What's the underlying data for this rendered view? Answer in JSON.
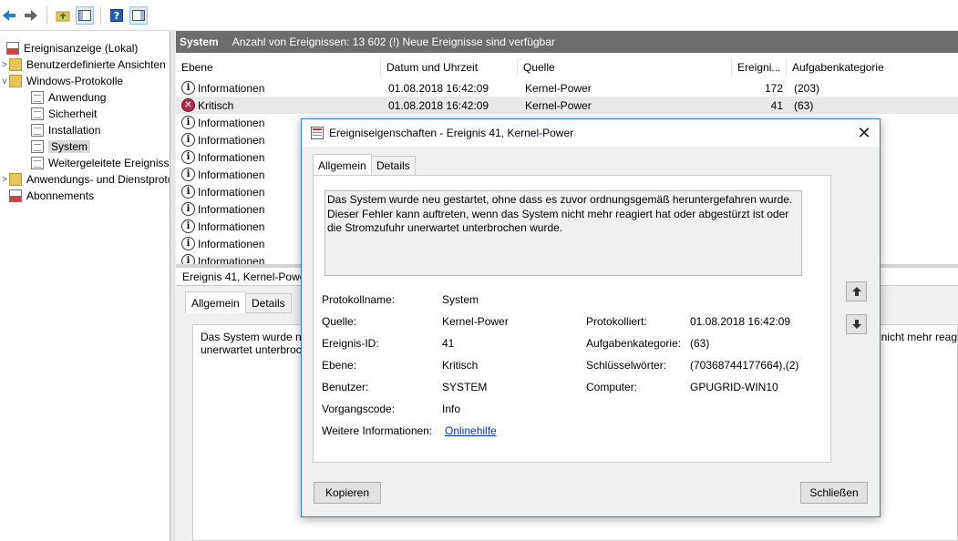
{
  "toolbar": {
    "icons": [
      "back-arrow-icon",
      "forward-arrow-icon",
      "up-folder-icon",
      "show-tree-icon",
      "help-icon",
      "action-pane-icon"
    ]
  },
  "tree": {
    "items": [
      {
        "label": "Ereignisanzeige (Lokal)",
        "expander": "",
        "icon": "event-viewer-icon"
      },
      {
        "label": "Benutzerdefinierte Ansichten",
        "expander": ">",
        "icon": "folder-icon"
      },
      {
        "label": "Windows-Protokolle",
        "expander": "v",
        "icon": "folder-icon"
      },
      {
        "label": "Anwendung",
        "expander": "",
        "icon": "log-icon"
      },
      {
        "label": "Sicherheit",
        "expander": "",
        "icon": "log-icon"
      },
      {
        "label": "Installation",
        "expander": "",
        "icon": "log-icon"
      },
      {
        "label": "System",
        "expander": "",
        "icon": "log-icon"
      },
      {
        "label": "Weitergeleitete Ereignisse",
        "expander": "",
        "icon": "log-icon"
      },
      {
        "label": "Anwendungs- und Dienstprotokolle",
        "expander": ">",
        "icon": "folder-icon"
      },
      {
        "label": "Abonnements",
        "expander": "",
        "icon": "subscriptions-icon"
      }
    ]
  },
  "pane": {
    "title": "System",
    "info": "Anzahl von Ereignissen: 13 602 (!) Neue Ereignisse sind verfügbar"
  },
  "list": {
    "columns": [
      "Ebene",
      "Datum und Uhrzeit",
      "Quelle",
      "Ereigni...",
      "Aufgabenkategorie"
    ],
    "rows": [
      {
        "level": "Informationen",
        "date": "01.08.2018 16:42:09",
        "source": "Kernel-Power",
        "id": "172",
        "category": "(203)"
      },
      {
        "level": "Kritisch",
        "date": "01.08.2018 16:42:09",
        "source": "Kernel-Power",
        "id": "41",
        "category": "(63)"
      },
      {
        "level": "Informationen",
        "date": "",
        "source": "",
        "id": "",
        "category": ""
      },
      {
        "level": "Informationen",
        "date": "",
        "source": "",
        "id": "",
        "category": ""
      },
      {
        "level": "Informationen",
        "date": "",
        "source": "",
        "id": "",
        "category": ""
      },
      {
        "level": "Informationen",
        "date": "",
        "source": "",
        "id": "",
        "category": ""
      },
      {
        "level": "Informationen",
        "date": "",
        "source": "",
        "id": "",
        "category": ""
      },
      {
        "level": "Informationen",
        "date": "",
        "source": "",
        "id": "",
        "category": ""
      },
      {
        "level": "Informationen",
        "date": "",
        "source": "",
        "id": "",
        "category": ""
      },
      {
        "level": "Informationen",
        "date": "",
        "source": "",
        "id": "",
        "category": ""
      },
      {
        "level": "Informationen",
        "date": "",
        "source": "",
        "id": "",
        "category": ""
      }
    ]
  },
  "preview": {
    "header": "Ereignis 41, Kernel-Power",
    "tabs": [
      "Allgemein",
      "Details"
    ],
    "text_left": "Das System wurde ne\nunerwartet unterbroc",
    "text_right": "nicht mehr reag"
  },
  "dialog": {
    "title": "Ereigniseigenschaften - Ereignis 41, Kernel-Power",
    "tabs": [
      "Allgemein",
      "Details"
    ],
    "description": "Das System wurde neu gestartet, ohne dass es zuvor ordnungsgemäß heruntergefahren wurde. Dieser Fehler kann auftreten, wenn das System nicht mehr reagiert hat oder abgestürzt ist oder die Stromzufuhr unerwartet unterbrochen wurde.",
    "fields": {
      "protokollname_label": "Protokollname:",
      "protokollname": "System",
      "quelle_label": "Quelle:",
      "quelle": "Kernel-Power",
      "ereignis_id_label": "Ereignis-ID:",
      "ereignis_id": "41",
      "ebene_label": "Ebene:",
      "ebene": "Kritisch",
      "benutzer_label": "Benutzer:",
      "benutzer": "SYSTEM",
      "vorgangscode_label": "Vorgangscode:",
      "vorgangscode": "Info",
      "weitere_label": "Weitere Informationen:",
      "weitere_link": "Onlinehilfe",
      "protokolliert_label": "Protokolliert:",
      "protokolliert": "01.08.2018 16:42:09",
      "aufgabenkategorie_label": "Aufgabenkategorie:",
      "aufgabenkategorie": "(63)",
      "schluesselwoerter_label": "Schlüsselwörter:",
      "schluesselwoerter": "(70368744177664),(2)",
      "computer_label": "Computer:",
      "computer": "GPUGRID-WIN10"
    },
    "copy_button": "Kopieren",
    "close_button": "Schließen"
  }
}
